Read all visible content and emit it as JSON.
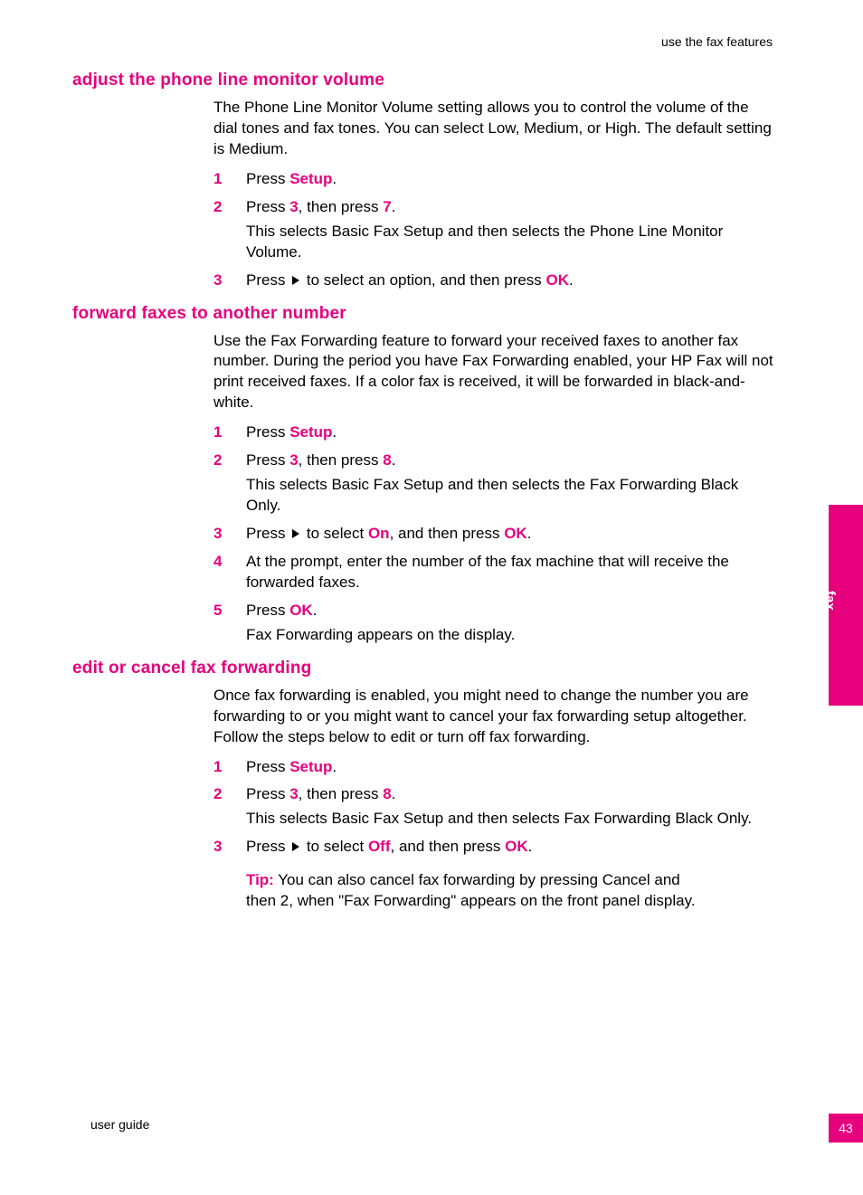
{
  "runningHead": "use the fax features",
  "sideTab": "fax",
  "footerLeft": "user guide",
  "pageNumber": "43",
  "sections": [
    {
      "heading": "adjust the phone line monitor volume",
      "intro": "The Phone Line Monitor Volume setting allows you to control the volume of the dial tones and fax tones. You can select Low, Medium, or High. The default setting is Medium.",
      "steps": [
        {
          "num": "1",
          "pre": "Press ",
          "kw1": "Setup",
          "post1": "."
        },
        {
          "num": "2",
          "pre": "Press ",
          "kw1": "3",
          "mid": ", then press ",
          "kw2": "7",
          "post2": ".",
          "sub": "This selects Basic Fax Setup and then selects the Phone Line Monitor Volume."
        },
        {
          "num": "3",
          "pre": "Press ",
          "arrow1": true,
          "mid": " to select an option, and then press ",
          "kw2": "OK",
          "post2": "."
        }
      ]
    },
    {
      "heading": "forward faxes to another number",
      "intro": "Use the Fax Forwarding feature to forward your received faxes to another fax number. During the period you have Fax Forwarding enabled, your HP Fax will not print received faxes. If a color fax is received, it will be forwarded in black-and-white.",
      "steps": [
        {
          "num": "1",
          "pre": "Press ",
          "kw1": "Setup",
          "post1": "."
        },
        {
          "num": "2",
          "pre": "Press ",
          "kw1": "3",
          "mid": ", then press ",
          "kw2": "8",
          "post2": ".",
          "sub": "This selects Basic Fax Setup and then selects the Fax Forwarding Black Only."
        },
        {
          "num": "3",
          "pre": "Press ",
          "arrow1": true,
          "mid": " to select ",
          "kw2": "On",
          "mid2": ", and then press ",
          "kw3": "OK",
          "post3": "."
        },
        {
          "num": "4",
          "pre": "At the prompt, enter the number of the fax machine that will receive the forwarded faxes."
        },
        {
          "num": "5",
          "pre": "Press ",
          "kw1": "OK",
          "post1": ".",
          "sub": "Fax Forwarding appears on the display."
        }
      ]
    },
    {
      "heading": "edit or cancel fax forwarding",
      "intro": "Once fax forwarding is enabled, you might need to change the number you are forwarding to or you might want to cancel your fax forwarding setup altogether. Follow the steps below to edit or turn off fax forwarding.",
      "steps": [
        {
          "num": "1",
          "pre": "Press ",
          "kw1": "Setup",
          "post1": "."
        },
        {
          "num": "2",
          "pre": "Press ",
          "kw1": "3",
          "mid": ", then press ",
          "kw2": "8",
          "post2": ".",
          "sub": "This selects Basic Fax Setup and then selects Fax Forwarding Black Only."
        },
        {
          "num": "3",
          "pre": "Press ",
          "arrow1": true,
          "mid": " to select ",
          "kw2": "Off",
          "mid2": ", and then press ",
          "kw3": "OK",
          "post3": "."
        }
      ],
      "tip": {
        "label": "Tip:",
        "text": " You can also cancel fax forwarding by pressing Cancel and then 2, when \"Fax Forwarding\" appears on the front panel display."
      }
    }
  ]
}
